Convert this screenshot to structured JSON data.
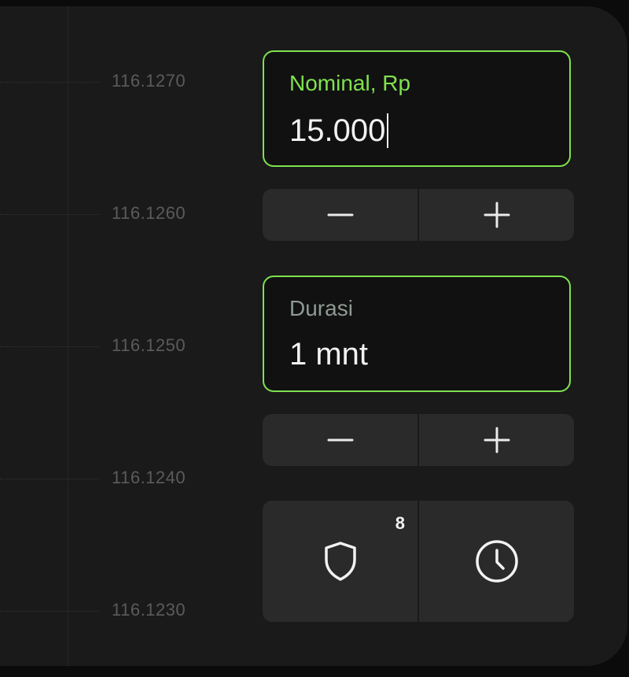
{
  "chart": {
    "price_levels": [
      "116.1270",
      "116.1260",
      "116.1250",
      "116.1240",
      "116.1230"
    ]
  },
  "amount": {
    "label": "Nominal, Rp",
    "value": "15.000",
    "label_color": "#7ee24f"
  },
  "amount_stepper": {
    "decrease_icon": "minus-icon",
    "increase_icon": "plus-icon"
  },
  "duration": {
    "label": "Durasi",
    "value": "1 mnt",
    "label_color": "#8e9a93"
  },
  "duration_stepper": {
    "decrease_icon": "minus-icon",
    "increase_icon": "plus-icon"
  },
  "actions": {
    "protection_icon": "shield-icon",
    "protection_badge": "8",
    "timer_icon": "clock-icon"
  },
  "colors": {
    "accent": "#7ee24f",
    "background": "#1a1a1a",
    "button": "#2a2a2a"
  }
}
